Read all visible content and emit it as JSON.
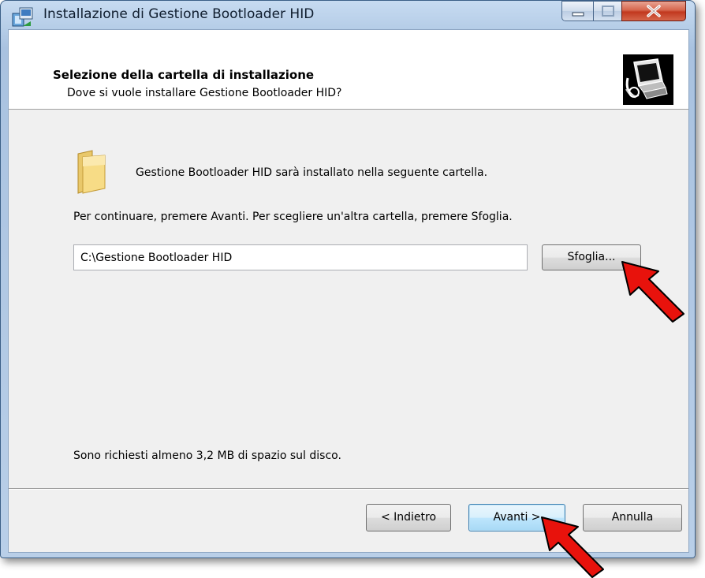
{
  "window": {
    "title": "Installazione di Gestione Bootloader HID",
    "controls": {
      "minimize_icon": "minimize-icon",
      "maximize_icon": "maximize-icon",
      "close_icon": "close-icon"
    }
  },
  "header": {
    "title": "Selezione della cartella di installazione",
    "subtitle": "Dove si vuole installare Gestione Bootloader HID?",
    "image_icon": "computer-install-icon"
  },
  "body": {
    "folder_icon": "folder-icon",
    "info_text": "Gestione Bootloader HID sarà installato nella seguente cartella.",
    "instruction_text": "Per continuare, premere Avanti. Per scegliere un'altra cartella, premere Sfoglia.",
    "install_path": "C:\\Gestione Bootloader HID",
    "browse_label": "Sfoglia...",
    "disk_space_text": "Sono richiesti almeno 3,2 MB di spazio sul disco."
  },
  "footer": {
    "back_label": "< Indietro",
    "next_label": "Avanti >",
    "cancel_label": "Annulla"
  },
  "annotations": {
    "arrow_color": "#e8120c",
    "arrows": [
      "arrow-browse",
      "arrow-next"
    ]
  }
}
